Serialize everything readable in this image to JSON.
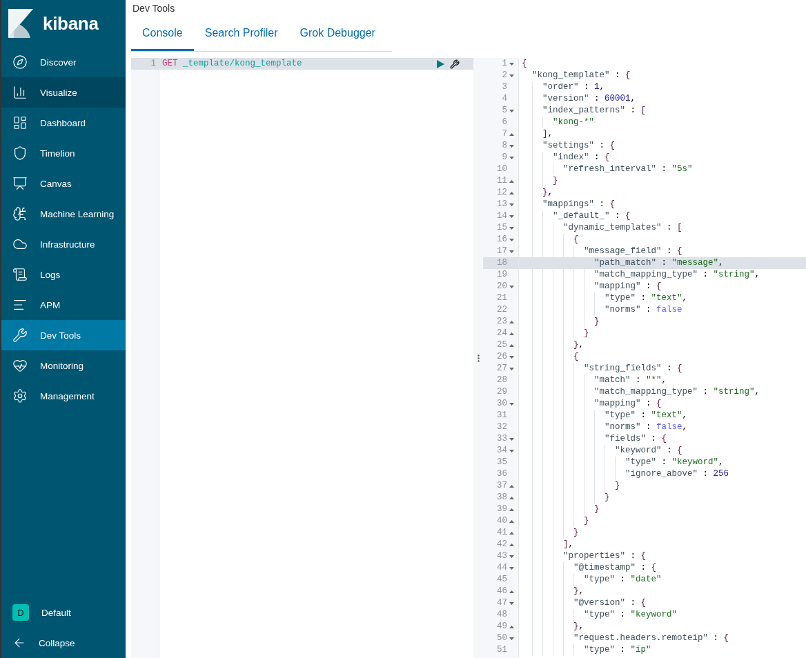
{
  "app": {
    "logo": "kibana"
  },
  "nav": {
    "items": [
      {
        "label": "Discover",
        "selected": false,
        "hovered": false
      },
      {
        "label": "Visualize",
        "selected": false,
        "hovered": true
      },
      {
        "label": "Dashboard",
        "selected": false,
        "hovered": false
      },
      {
        "label": "Timelion",
        "selected": false,
        "hovered": false
      },
      {
        "label": "Canvas",
        "selected": false,
        "hovered": false
      },
      {
        "label": "Machine Learning",
        "selected": false,
        "hovered": false
      },
      {
        "label": "Infrastructure",
        "selected": false,
        "hovered": false
      },
      {
        "label": "Logs",
        "selected": false,
        "hovered": false
      },
      {
        "label": "APM",
        "selected": false,
        "hovered": false
      },
      {
        "label": "Dev Tools",
        "selected": true,
        "hovered": false
      },
      {
        "label": "Monitoring",
        "selected": false,
        "hovered": false
      },
      {
        "label": "Management",
        "selected": false,
        "hovered": false
      }
    ]
  },
  "space": {
    "initial": "D",
    "label": "Default"
  },
  "collapse": {
    "label": "Collapse"
  },
  "header": {
    "title": "Dev Tools"
  },
  "tabs": [
    {
      "label": "Console",
      "selected": true
    },
    {
      "label": "Search Profiler",
      "selected": false
    },
    {
      "label": "Grok Debugger",
      "selected": false
    }
  ],
  "request_editor": {
    "lines": [
      {
        "number": "1",
        "active": true,
        "tokens": [
          {
            "kind": "method",
            "text": "GET"
          },
          {
            "kind": "url",
            "text": " _template/kong_template"
          }
        ]
      }
    ]
  },
  "response_editor": {
    "lines": [
      {
        "number": "1",
        "active": false,
        "kind": "open",
        "tokens": [
          {
            "kind": "brace",
            "text": "{"
          }
        ]
      },
      {
        "number": "2",
        "active": false,
        "kind": "open",
        "tokens": [
          {
            "kind": "key",
            "text": "  \"kong_template\""
          },
          {
            "kind": "punct",
            "text": " : "
          },
          {
            "kind": "brace",
            "text": "{"
          }
        ]
      },
      {
        "number": "3",
        "active": false,
        "kind": "plain",
        "tokens": [
          {
            "kind": "key",
            "text": "    \"order\""
          },
          {
            "kind": "punct",
            "text": " : "
          },
          {
            "kind": "num",
            "text": "1"
          },
          {
            "kind": "punct",
            "text": ","
          }
        ]
      },
      {
        "number": "4",
        "active": false,
        "kind": "plain",
        "tokens": [
          {
            "kind": "key",
            "text": "    \"version\""
          },
          {
            "kind": "punct",
            "text": " : "
          },
          {
            "kind": "num",
            "text": "60001"
          },
          {
            "kind": "punct",
            "text": ","
          }
        ]
      },
      {
        "number": "5",
        "active": false,
        "kind": "open",
        "tokens": [
          {
            "kind": "key",
            "text": "    \"index_patterns\""
          },
          {
            "kind": "punct",
            "text": " : "
          },
          {
            "kind": "brace",
            "text": "["
          }
        ]
      },
      {
        "number": "6",
        "active": false,
        "kind": "plain",
        "tokens": [
          {
            "kind": "str",
            "text": "      \"kong-*\""
          }
        ]
      },
      {
        "number": "7",
        "active": false,
        "kind": "close",
        "tokens": [
          {
            "kind": "brace",
            "text": "    ]"
          },
          {
            "kind": "punct",
            "text": ","
          }
        ]
      },
      {
        "number": "8",
        "active": false,
        "kind": "open",
        "tokens": [
          {
            "kind": "key",
            "text": "    \"settings\""
          },
          {
            "kind": "punct",
            "text": " : "
          },
          {
            "kind": "brace",
            "text": "{"
          }
        ]
      },
      {
        "number": "9",
        "active": false,
        "kind": "open",
        "tokens": [
          {
            "kind": "key",
            "text": "      \"index\""
          },
          {
            "kind": "punct",
            "text": " : "
          },
          {
            "kind": "brace",
            "text": "{"
          }
        ]
      },
      {
        "number": "10",
        "active": false,
        "kind": "plain",
        "tokens": [
          {
            "kind": "key",
            "text": "        \"refresh_interval\""
          },
          {
            "kind": "punct",
            "text": " : "
          },
          {
            "kind": "str",
            "text": "\"5s\""
          }
        ]
      },
      {
        "number": "11",
        "active": false,
        "kind": "close",
        "tokens": [
          {
            "kind": "brace",
            "text": "      }"
          }
        ]
      },
      {
        "number": "12",
        "active": false,
        "kind": "close",
        "tokens": [
          {
            "kind": "brace",
            "text": "    }"
          },
          {
            "kind": "punct",
            "text": ","
          }
        ]
      },
      {
        "number": "13",
        "active": false,
        "kind": "open",
        "tokens": [
          {
            "kind": "key",
            "text": "    \"mappings\""
          },
          {
            "kind": "punct",
            "text": " : "
          },
          {
            "kind": "brace",
            "text": "{"
          }
        ]
      },
      {
        "number": "14",
        "active": false,
        "kind": "open",
        "tokens": [
          {
            "kind": "key",
            "text": "      \"_default_\""
          },
          {
            "kind": "punct",
            "text": " : "
          },
          {
            "kind": "brace",
            "text": "{"
          }
        ]
      },
      {
        "number": "15",
        "active": false,
        "kind": "open",
        "tokens": [
          {
            "kind": "key",
            "text": "        \"dynamic_templates\""
          },
          {
            "kind": "punct",
            "text": " : "
          },
          {
            "kind": "brace",
            "text": "["
          }
        ]
      },
      {
        "number": "16",
        "active": false,
        "kind": "open",
        "tokens": [
          {
            "kind": "brace",
            "text": "          {"
          }
        ]
      },
      {
        "number": "17",
        "active": false,
        "kind": "open",
        "tokens": [
          {
            "kind": "key",
            "text": "            \"message_field\""
          },
          {
            "kind": "punct",
            "text": " : "
          },
          {
            "kind": "brace",
            "text": "{"
          }
        ]
      },
      {
        "number": "18",
        "active": true,
        "kind": "plain",
        "tokens": [
          {
            "kind": "key",
            "text": "              \"path_match\""
          },
          {
            "kind": "punct",
            "text": " : "
          },
          {
            "kind": "str",
            "text": "\"message\""
          },
          {
            "kind": "punct",
            "text": ","
          }
        ]
      },
      {
        "number": "19",
        "active": false,
        "kind": "plain",
        "tokens": [
          {
            "kind": "key",
            "text": "              \"match_mapping_type\""
          },
          {
            "kind": "punct",
            "text": " : "
          },
          {
            "kind": "str",
            "text": "\"string\""
          },
          {
            "kind": "punct",
            "text": ","
          }
        ]
      },
      {
        "number": "20",
        "active": false,
        "kind": "open",
        "tokens": [
          {
            "kind": "key",
            "text": "              \"mapping\""
          },
          {
            "kind": "punct",
            "text": " : "
          },
          {
            "kind": "brace",
            "text": "{"
          }
        ]
      },
      {
        "number": "21",
        "active": false,
        "kind": "plain",
        "tokens": [
          {
            "kind": "key",
            "text": "                \"type\""
          },
          {
            "kind": "punct",
            "text": " : "
          },
          {
            "kind": "str",
            "text": "\"text\""
          },
          {
            "kind": "punct",
            "text": ","
          }
        ]
      },
      {
        "number": "22",
        "active": false,
        "kind": "plain",
        "tokens": [
          {
            "kind": "key",
            "text": "                \"norms\""
          },
          {
            "kind": "punct",
            "text": " : "
          },
          {
            "kind": "bool",
            "text": "false"
          }
        ]
      },
      {
        "number": "23",
        "active": false,
        "kind": "close",
        "tokens": [
          {
            "kind": "brace",
            "text": "              }"
          }
        ]
      },
      {
        "number": "24",
        "active": false,
        "kind": "close",
        "tokens": [
          {
            "kind": "brace",
            "text": "            }"
          }
        ]
      },
      {
        "number": "25",
        "active": false,
        "kind": "close",
        "tokens": [
          {
            "kind": "brace",
            "text": "          }"
          },
          {
            "kind": "punct",
            "text": ","
          }
        ]
      },
      {
        "number": "26",
        "active": false,
        "kind": "open",
        "tokens": [
          {
            "kind": "brace",
            "text": "          {"
          }
        ]
      },
      {
        "number": "27",
        "active": false,
        "kind": "open",
        "tokens": [
          {
            "kind": "key",
            "text": "            \"string_fields\""
          },
          {
            "kind": "punct",
            "text": " : "
          },
          {
            "kind": "brace",
            "text": "{"
          }
        ]
      },
      {
        "number": "28",
        "active": false,
        "kind": "plain",
        "tokens": [
          {
            "kind": "key",
            "text": "              \"match\""
          },
          {
            "kind": "punct",
            "text": " : "
          },
          {
            "kind": "str",
            "text": "\"*\""
          },
          {
            "kind": "punct",
            "text": ","
          }
        ]
      },
      {
        "number": "29",
        "active": false,
        "kind": "plain",
        "tokens": [
          {
            "kind": "key",
            "text": "              \"match_mapping_type\""
          },
          {
            "kind": "punct",
            "text": " : "
          },
          {
            "kind": "str",
            "text": "\"string\""
          },
          {
            "kind": "punct",
            "text": ","
          }
        ]
      },
      {
        "number": "30",
        "active": false,
        "kind": "open",
        "tokens": [
          {
            "kind": "key",
            "text": "              \"mapping\""
          },
          {
            "kind": "punct",
            "text": " : "
          },
          {
            "kind": "brace",
            "text": "{"
          }
        ]
      },
      {
        "number": "31",
        "active": false,
        "kind": "plain",
        "tokens": [
          {
            "kind": "key",
            "text": "                \"type\""
          },
          {
            "kind": "punct",
            "text": " : "
          },
          {
            "kind": "str",
            "text": "\"text\""
          },
          {
            "kind": "punct",
            "text": ","
          }
        ]
      },
      {
        "number": "32",
        "active": false,
        "kind": "plain",
        "tokens": [
          {
            "kind": "key",
            "text": "                \"norms\""
          },
          {
            "kind": "punct",
            "text": " : "
          },
          {
            "kind": "bool",
            "text": "false"
          },
          {
            "kind": "punct",
            "text": ","
          }
        ]
      },
      {
        "number": "33",
        "active": false,
        "kind": "open",
        "tokens": [
          {
            "kind": "key",
            "text": "                \"fields\""
          },
          {
            "kind": "punct",
            "text": " : "
          },
          {
            "kind": "brace",
            "text": "{"
          }
        ]
      },
      {
        "number": "34",
        "active": false,
        "kind": "open",
        "tokens": [
          {
            "kind": "key",
            "text": "                  \"keyword\""
          },
          {
            "kind": "punct",
            "text": " : "
          },
          {
            "kind": "brace",
            "text": "{"
          }
        ]
      },
      {
        "number": "35",
        "active": false,
        "kind": "plain",
        "tokens": [
          {
            "kind": "key",
            "text": "                    \"type\""
          },
          {
            "kind": "punct",
            "text": " : "
          },
          {
            "kind": "str",
            "text": "\"keyword\""
          },
          {
            "kind": "punct",
            "text": ","
          }
        ]
      },
      {
        "number": "36",
        "active": false,
        "kind": "plain",
        "tokens": [
          {
            "kind": "key",
            "text": "                    \"ignore_above\""
          },
          {
            "kind": "punct",
            "text": " : "
          },
          {
            "kind": "num",
            "text": "256"
          }
        ]
      },
      {
        "number": "37",
        "active": false,
        "kind": "close",
        "tokens": [
          {
            "kind": "brace",
            "text": "                  }"
          }
        ]
      },
      {
        "number": "38",
        "active": false,
        "kind": "close",
        "tokens": [
          {
            "kind": "brace",
            "text": "                }"
          }
        ]
      },
      {
        "number": "39",
        "active": false,
        "kind": "close",
        "tokens": [
          {
            "kind": "brace",
            "text": "              }"
          }
        ]
      },
      {
        "number": "40",
        "active": false,
        "kind": "close",
        "tokens": [
          {
            "kind": "brace",
            "text": "            }"
          }
        ]
      },
      {
        "number": "41",
        "active": false,
        "kind": "close",
        "tokens": [
          {
            "kind": "brace",
            "text": "          }"
          }
        ]
      },
      {
        "number": "42",
        "active": false,
        "kind": "close",
        "tokens": [
          {
            "kind": "brace",
            "text": "        ]"
          },
          {
            "kind": "punct",
            "text": ","
          }
        ]
      },
      {
        "number": "43",
        "active": false,
        "kind": "open",
        "tokens": [
          {
            "kind": "key",
            "text": "        \"properties\""
          },
          {
            "kind": "punct",
            "text": " : "
          },
          {
            "kind": "brace",
            "text": "{"
          }
        ]
      },
      {
        "number": "44",
        "active": false,
        "kind": "open",
        "tokens": [
          {
            "kind": "key",
            "text": "          \"@timestamp\""
          },
          {
            "kind": "punct",
            "text": " : "
          },
          {
            "kind": "brace",
            "text": "{"
          }
        ]
      },
      {
        "number": "45",
        "active": false,
        "kind": "plain",
        "tokens": [
          {
            "kind": "key",
            "text": "            \"type\""
          },
          {
            "kind": "punct",
            "text": " : "
          },
          {
            "kind": "str",
            "text": "\"date\""
          }
        ]
      },
      {
        "number": "46",
        "active": false,
        "kind": "close",
        "tokens": [
          {
            "kind": "brace",
            "text": "          }"
          },
          {
            "kind": "punct",
            "text": ","
          }
        ]
      },
      {
        "number": "47",
        "active": false,
        "kind": "open",
        "tokens": [
          {
            "kind": "key",
            "text": "          \"@version\""
          },
          {
            "kind": "punct",
            "text": " : "
          },
          {
            "kind": "brace",
            "text": "{"
          }
        ]
      },
      {
        "number": "48",
        "active": false,
        "kind": "plain",
        "tokens": [
          {
            "kind": "key",
            "text": "            \"type\""
          },
          {
            "kind": "punct",
            "text": " : "
          },
          {
            "kind": "str",
            "text": "\"keyword\""
          }
        ]
      },
      {
        "number": "49",
        "active": false,
        "kind": "close",
        "tokens": [
          {
            "kind": "brace",
            "text": "          }"
          },
          {
            "kind": "punct",
            "text": ","
          }
        ]
      },
      {
        "number": "50",
        "active": false,
        "kind": "open",
        "tokens": [
          {
            "kind": "key",
            "text": "          \"request.headers.remoteip\""
          },
          {
            "kind": "punct",
            "text": " : "
          },
          {
            "kind": "brace",
            "text": "{"
          }
        ]
      },
      {
        "number": "51",
        "active": false,
        "kind": "plain",
        "tokens": [
          {
            "kind": "key",
            "text": "            \"type\""
          },
          {
            "kind": "punct",
            "text": " : "
          },
          {
            "kind": "str",
            "text": "\"ip\""
          }
        ]
      }
    ]
  }
}
